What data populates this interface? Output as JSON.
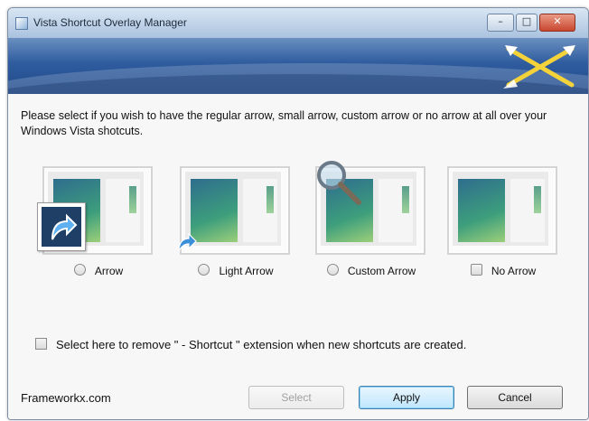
{
  "window": {
    "title": "Vista Shortcut Overlay Manager"
  },
  "content": {
    "description": "Please select if you wish to have the regular arrow, small arrow, custom arrow or no arrow at all over your Windows Vista shotcuts.",
    "options": [
      {
        "label": "Arrow",
        "icon": "large-shortcut-arrow-icon"
      },
      {
        "label": "Light Arrow",
        "icon": "small-shortcut-arrow-icon"
      },
      {
        "label": "Custom Arrow",
        "icon": "magnifier-icon"
      },
      {
        "label": "No Arrow",
        "icon": "none"
      }
    ],
    "remove_extension_label": "Select here to remove \" - Shortcut \" extension when new shortcuts are created."
  },
  "footer": {
    "site": "Frameworkx.com",
    "buttons": {
      "select": "Select",
      "apply": "Apply",
      "cancel": "Cancel"
    }
  },
  "colors": {
    "banner": "#2f5c9e",
    "accent_button": "#bee6fd",
    "close_button": "#c9472f"
  }
}
